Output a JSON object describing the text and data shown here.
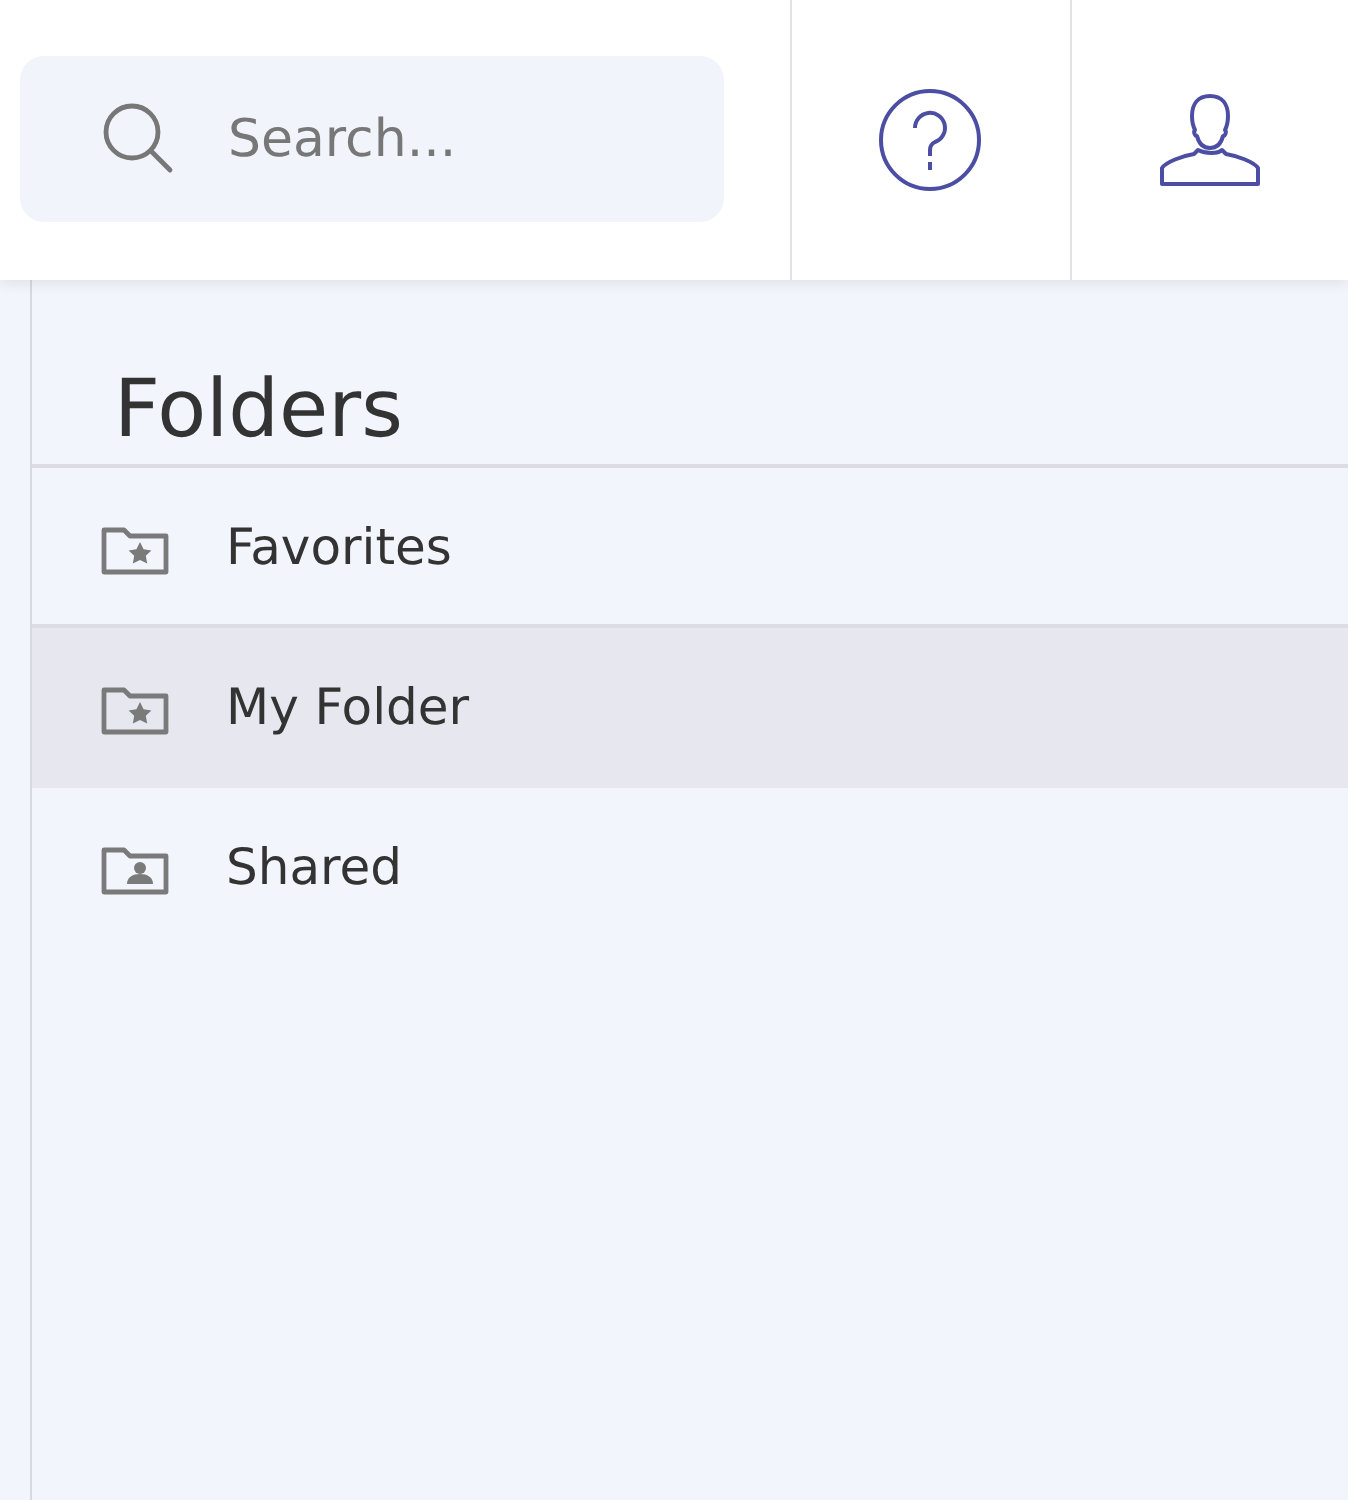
{
  "header": {
    "search": {
      "placeholder": "Search..."
    }
  },
  "folders": {
    "title": "Folders",
    "items": [
      {
        "label": "Favorites",
        "kind": "starred",
        "selected": false
      },
      {
        "label": "My Folder",
        "kind": "starred",
        "selected": true
      },
      {
        "label": "Shared",
        "kind": "shared",
        "selected": false
      }
    ]
  }
}
